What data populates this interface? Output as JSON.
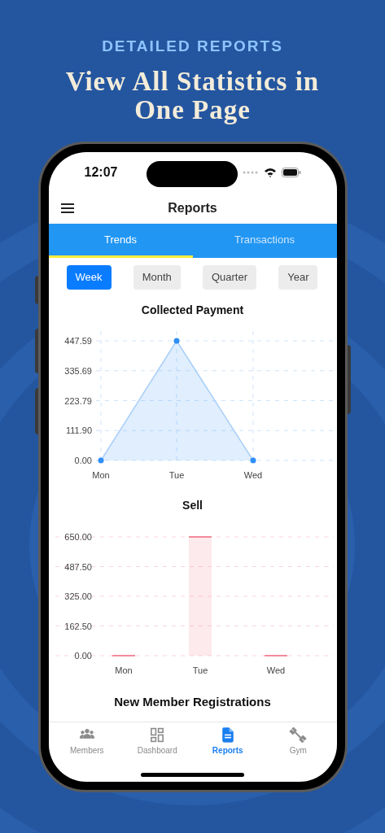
{
  "promo": {
    "kicker": "DETAILED REPORTS",
    "headline_lines": [
      "View All Statistics in",
      "One Page"
    ]
  },
  "status_bar": {
    "time": "12:07"
  },
  "header": {
    "title": "Reports"
  },
  "tabs": [
    {
      "label": "Trends",
      "selected": true
    },
    {
      "label": "Transactions",
      "selected": false
    }
  ],
  "periods": [
    {
      "label": "Week",
      "selected": true
    },
    {
      "label": "Month",
      "selected": false
    },
    {
      "label": "Quarter",
      "selected": false
    },
    {
      "label": "Year",
      "selected": false
    }
  ],
  "charts": [
    {
      "chart_data": {
        "type": "area",
        "title": "Collected Payment",
        "categories": [
          "Mon",
          "Tue",
          "Wed"
        ],
        "grid": true,
        "series": [
          {
            "color": "#2f8ef5",
            "values": [
              0,
              447.59,
              0
            ]
          }
        ],
        "ylim": [
          0,
          447.59
        ],
        "yticks": [
          {
            "value": 0,
            "label": "0.00"
          },
          {
            "value": 111.9,
            "label": "111.90"
          },
          {
            "value": 223.79,
            "label": "223.79"
          },
          {
            "value": 335.69,
            "label": "335.69"
          },
          {
            "value": 447.59,
            "label": "447.59"
          }
        ]
      }
    },
    {
      "chart_data": {
        "type": "bar",
        "title": "Sell",
        "categories": [
          "Mon",
          "Tue",
          "Wed"
        ],
        "grid": true,
        "series": [
          {
            "color": "#f48a9c",
            "values": [
              0,
              650,
              0
            ]
          }
        ],
        "ylim": [
          0,
          650
        ],
        "yticks": [
          {
            "value": 0,
            "label": "0.00"
          },
          {
            "value": 162.5,
            "label": "162.50"
          },
          {
            "value": 325,
            "label": "325.00"
          },
          {
            "value": 487.5,
            "label": "487.50"
          },
          {
            "value": 650,
            "label": "650.00"
          }
        ]
      }
    }
  ],
  "next_section_title": "New Member Registrations",
  "bottom_nav": [
    {
      "kind": "members",
      "label": "Members",
      "selected": false
    },
    {
      "kind": "dashboard",
      "label": "Dashboard",
      "selected": false
    },
    {
      "kind": "reports",
      "label": "Reports",
      "selected": true
    },
    {
      "kind": "gym",
      "label": "Gym",
      "selected": false
    }
  ]
}
